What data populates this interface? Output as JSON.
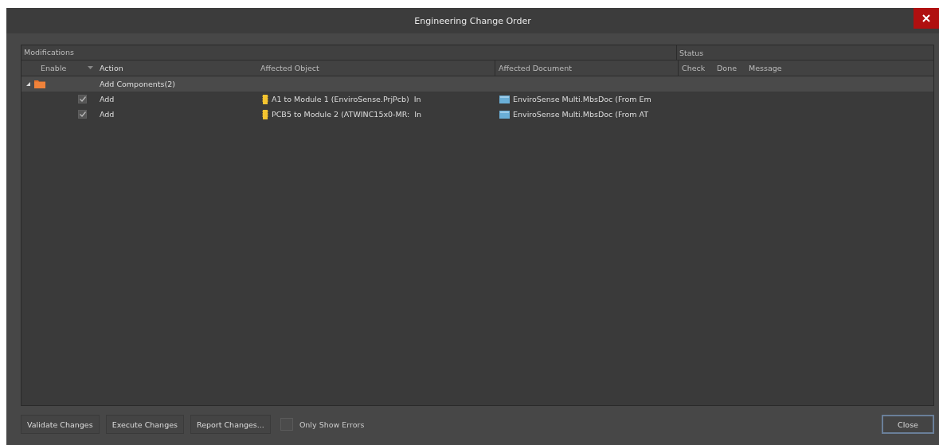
{
  "window": {
    "title": "Engineering Change Order"
  },
  "table": {
    "group_headers": [
      "Modifications",
      "Status"
    ],
    "columns": [
      "Enable",
      "Action",
      "Affected Object",
      "Affected Document",
      "Check",
      "Done",
      "Message"
    ],
    "groups": [
      {
        "label": "Add Components(2)",
        "expanded": true,
        "children": [
          {
            "enabled": true,
            "action": "Add",
            "affected_object": "A1 to Module 1 (EnviroSense.PrjPcb)",
            "object_suffix": "In",
            "affected_document": "EnviroSense Multi.MbsDoc (From Em"
          },
          {
            "enabled": true,
            "action": "Add",
            "affected_object": "PCB5 to Module 2 (ATWINC15x0-MR:",
            "object_suffix": "In",
            "affected_document": "EnviroSense Multi.MbsDoc (From AT"
          }
        ]
      }
    ]
  },
  "buttons": [
    "Validate Changes",
    "Execute Changes",
    "Report Changes..."
  ],
  "only_show_errors": {
    "label": "Only Show Errors",
    "checked": false
  },
  "close_button": "Close"
}
